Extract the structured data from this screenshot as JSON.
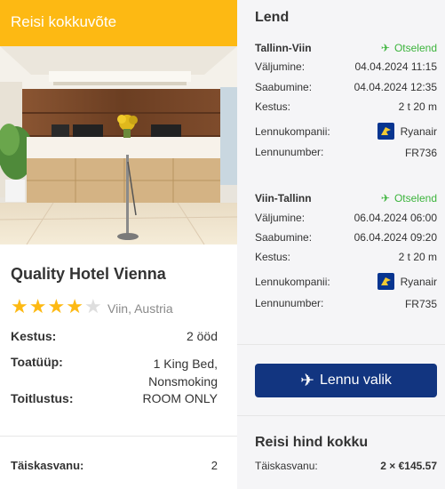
{
  "banner": {
    "title": "Reisi kokkuvõte"
  },
  "hotel": {
    "name": "Quality Hotel Vienna",
    "rating": 4,
    "max_rating": 5,
    "location": "Viin, Austria",
    "details": [
      {
        "label": "Kestus:",
        "value": "2 ööd"
      },
      {
        "label": "Toatüüp:",
        "value": "1 King Bed, Nonsmoking"
      },
      {
        "label": "Toitlustus:",
        "value": "ROOM ONLY"
      }
    ]
  },
  "travellers": {
    "label": "Täiskasvanu:",
    "value": "2"
  },
  "flight": {
    "title": "Lend",
    "legs": [
      {
        "route": "Tallinn-Viin",
        "type": "Otselend",
        "departure_label": "Väljumine:",
        "departure": "04.04.2024 11:15",
        "arrival_label": "Saabumine:",
        "arrival": "04.04.2024 12:35",
        "duration_label": "Kestus:",
        "duration": "2 t 20 m",
        "airline_label": "Lennukompanii:",
        "airline": "Ryanair",
        "number_label": "Lennunumber:",
        "number": "FR736"
      },
      {
        "route": "Viin-Tallinn",
        "type": "Otselend",
        "departure_label": "Väljumine:",
        "departure": "06.04.2024 06:00",
        "arrival_label": "Saabumine:",
        "arrival": "06.04.2024 09:20",
        "duration_label": "Kestus:",
        "duration": "2 t 20 m",
        "airline_label": "Lennukompanii:",
        "airline": "Ryanair",
        "number_label": "Lennunumber:",
        "number": "FR735"
      }
    ],
    "select_button": "Lennu valik"
  },
  "price": {
    "title": "Reisi hind kokku",
    "label": "Täiskasvanu:",
    "value": "2 × €145.57"
  },
  "colors": {
    "accent": "#fdb913",
    "button": "#123580",
    "direct": "#3cb43c"
  },
  "icons": {
    "plane": "plane-icon",
    "star": "star-icon",
    "airline_logo": "ryanair-logo-icon"
  }
}
